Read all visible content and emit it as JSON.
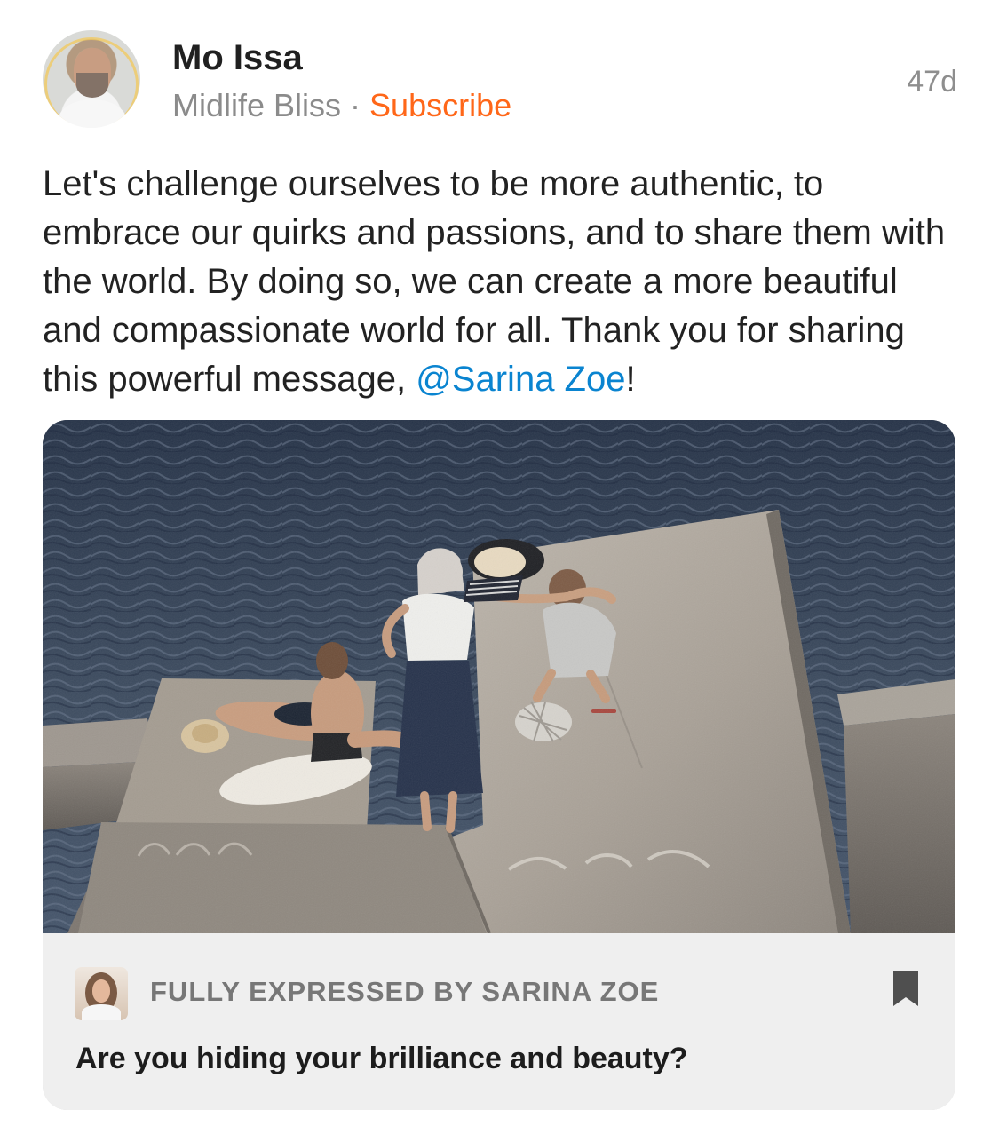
{
  "post": {
    "author_name": "Mo Issa",
    "publication": "Midlife Bliss",
    "separator": " · ",
    "subscribe_label": "Subscribe",
    "age": "47d",
    "body_before_mention": "Let's challenge ourselves to be more authentic, to embrace our quirks and passions, and to share them with the world. By doing so, we can create a more beautiful and compassionate world for all. Thank you for sharing this powerful message, ",
    "mention": "@Sarina Zoe",
    "body_after_mention": "!"
  },
  "shared_card": {
    "byline": "FULLY EXPRESSED BY SARINA ZOE",
    "title": "Are you hiding your brilliance and beauty?"
  },
  "colors": {
    "subscribe_accent": "#ff6719",
    "mention_link": "#0a84d0",
    "secondary_text": "#8b8b8b"
  },
  "icons": {
    "bookmark": "bookmark-icon"
  }
}
